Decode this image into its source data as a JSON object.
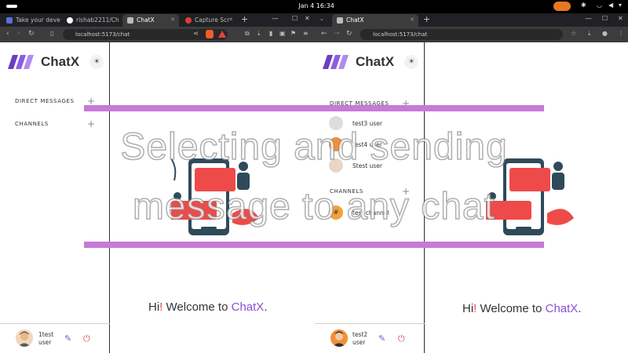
{
  "system": {
    "clock": "Jan 4  16:34"
  },
  "left_window": {
    "tabs": [
      {
        "label": "Take your devel",
        "active": false
      },
      {
        "label": "rishab2211/Ch",
        "active": false
      },
      {
        "label": "ChatX",
        "active": true
      },
      {
        "label": "Capture Scr",
        "active": false
      }
    ],
    "url": "localhost:5173/chat",
    "app": {
      "brand": "ChatX",
      "direct_messages_label": "DIRECT MESSAGES",
      "channels_label": "CHANNELS",
      "greeting": {
        "prefix": "Hi",
        "bang": "!",
        "middle": " Welcome to ",
        "brand": "ChatX",
        "suffix": "."
      },
      "user": {
        "name_line1": "1test",
        "name_line2": "user"
      }
    }
  },
  "right_window": {
    "tab": {
      "label": "ChatX"
    },
    "url": "localhost:5173/chat",
    "app": {
      "brand": "ChatX",
      "direct_messages_label": "DIRECT MESSAGES",
      "contacts": [
        "test3 user",
        "test4 user",
        "Stest user"
      ],
      "channels_label": "CHANNELS",
      "channel_initial": "#",
      "channel_name": "test channel",
      "greeting": {
        "prefix": "Hi",
        "bang": "!",
        "middle": " Welcome to ",
        "brand": "ChatX",
        "suffix": "."
      },
      "user": {
        "name_line1": "test2",
        "name_line2": "user"
      }
    }
  },
  "overlay": {
    "line1": "Selecting and sending",
    "line2": "message to any chat"
  },
  "colors": {
    "accent": "#8a4fd8",
    "overlay_band": "#c77ad6",
    "chat_bubble": "#ef4a4a",
    "illustration_dark": "#2f4a5a"
  }
}
